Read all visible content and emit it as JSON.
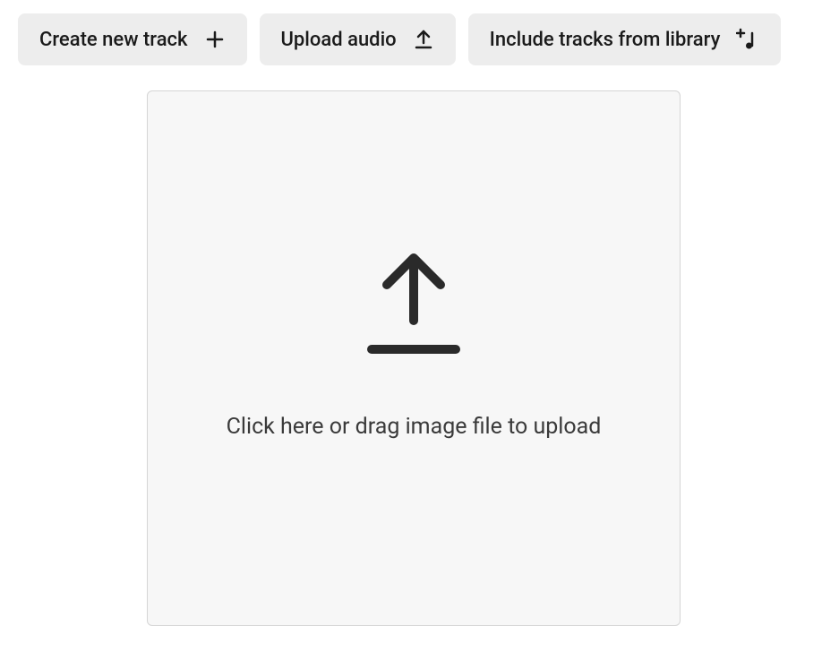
{
  "buttons": {
    "create_track": {
      "label": "Create new track"
    },
    "upload_audio": {
      "label": "Upload audio"
    },
    "include_library": {
      "label": "Include tracks from library"
    }
  },
  "dropzone": {
    "prompt": "Click here or drag image file to upload"
  }
}
